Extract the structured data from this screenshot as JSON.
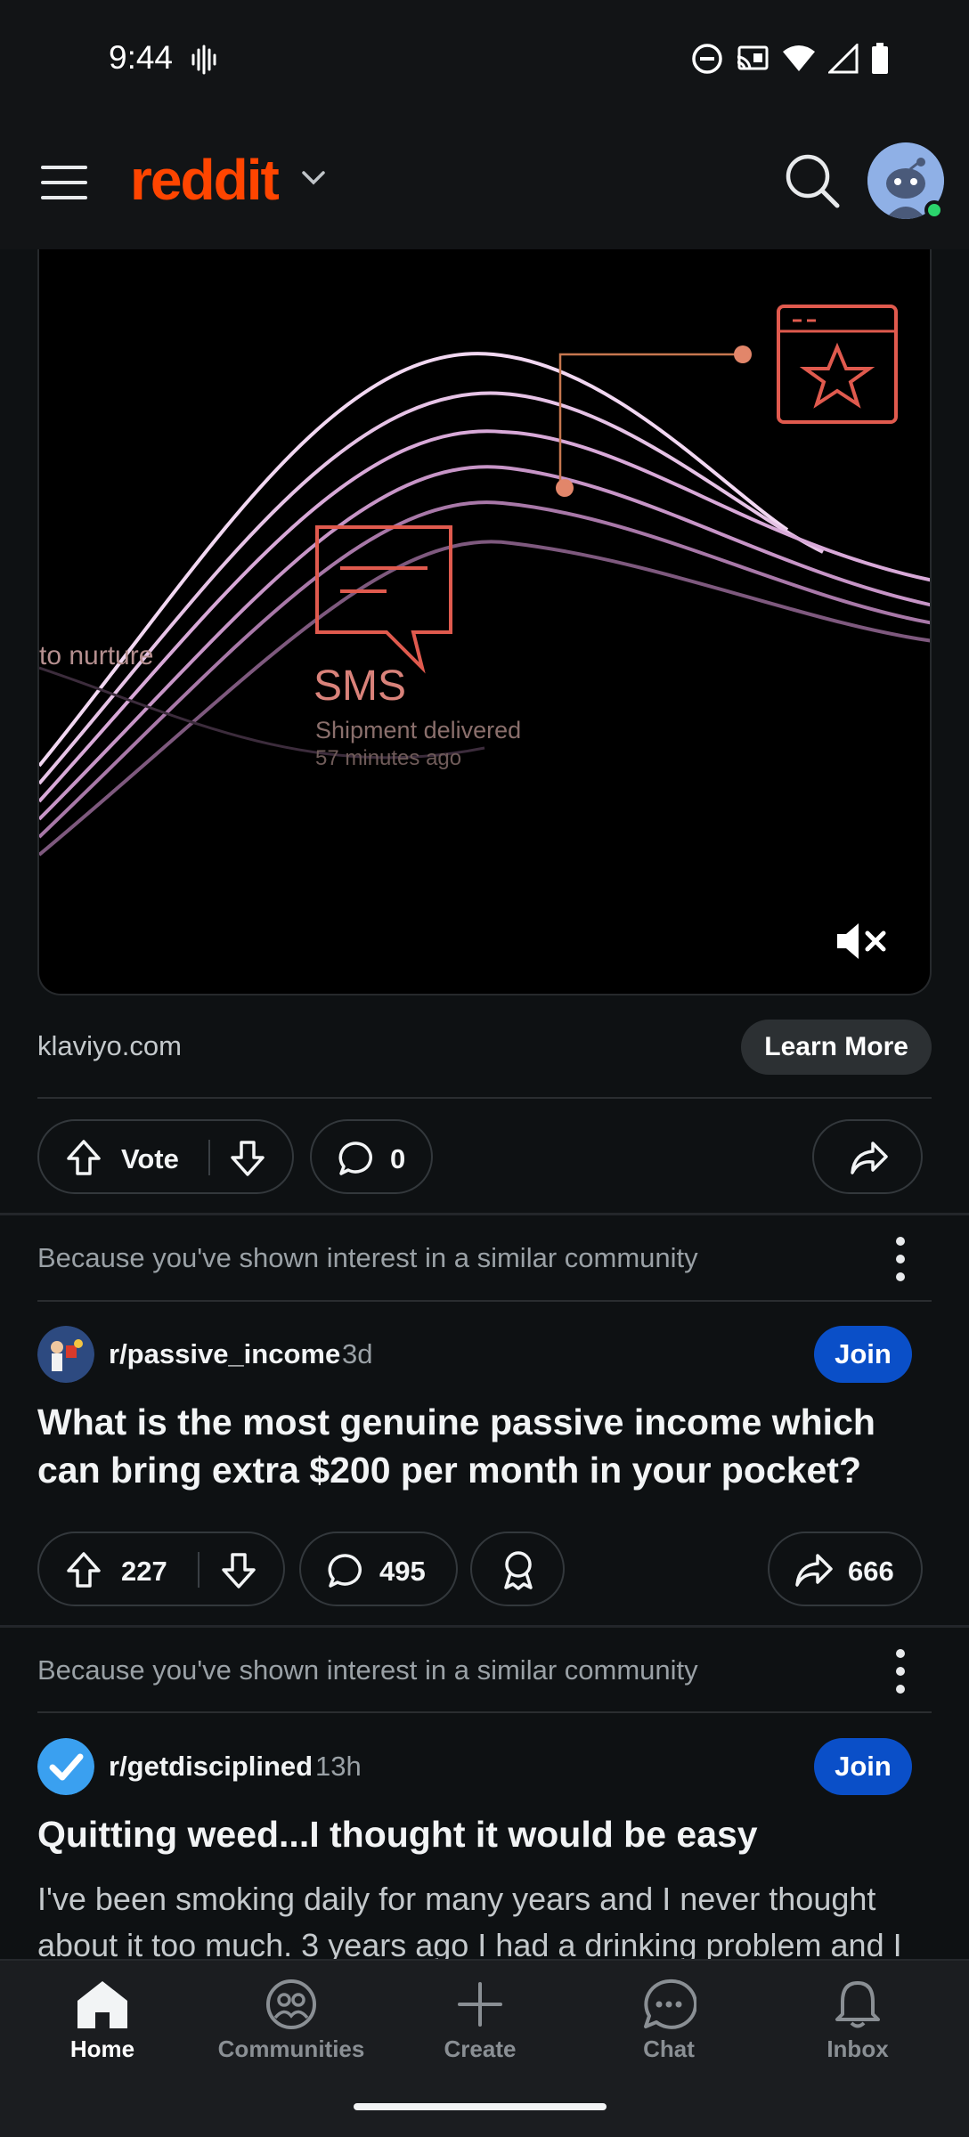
{
  "status_bar": {
    "time": "9:44",
    "icons": [
      "vibrate-icon",
      "dnd-icon",
      "cast-icon",
      "wifi-icon",
      "signal-icon",
      "battery-icon"
    ]
  },
  "header": {
    "logo": "reddit",
    "icons": [
      "menu-icon",
      "chevron-down-icon",
      "search-icon",
      "avatar"
    ]
  },
  "ad": {
    "video_texts": {
      "nurture": "to nurture",
      "sms": "SMS",
      "shipment": "Shipment delivered",
      "time_ago": "57 minutes ago"
    },
    "domain": "klaviyo.com",
    "cta_label": "Learn More",
    "vote_label": "Vote",
    "comments": "0"
  },
  "feed": [
    {
      "reason": "Because you've shown interest in a similar community",
      "subreddit": "r/passive_income",
      "age": "3d",
      "join_label": "Join",
      "title": "What is the most genuine passive income which can bring extra $200 per month in your pocket?",
      "score": "227",
      "comments": "495",
      "shares": "666"
    },
    {
      "reason": "Because you've shown interest in a similar community",
      "subreddit": "r/getdisciplined",
      "age": "13h",
      "join_label": "Join",
      "title": "Quitting weed...I thought it would be easy",
      "body": "I've been smoking daily for many years and I never thought about it too much. 3 years ago I had a drinking problem and I"
    }
  ],
  "bottom_nav": {
    "items": [
      {
        "label": "Home",
        "icon": "home-icon",
        "active": true
      },
      {
        "label": "Communities",
        "icon": "communities-icon",
        "active": false
      },
      {
        "label": "Create",
        "icon": "plus-icon",
        "active": false
      },
      {
        "label": "Chat",
        "icon": "chat-icon",
        "active": false
      },
      {
        "label": "Inbox",
        "icon": "bell-icon",
        "active": false
      }
    ]
  },
  "colors": {
    "brand": "#ff4500",
    "join": "#0a4fc8",
    "background": "#0e1113"
  }
}
